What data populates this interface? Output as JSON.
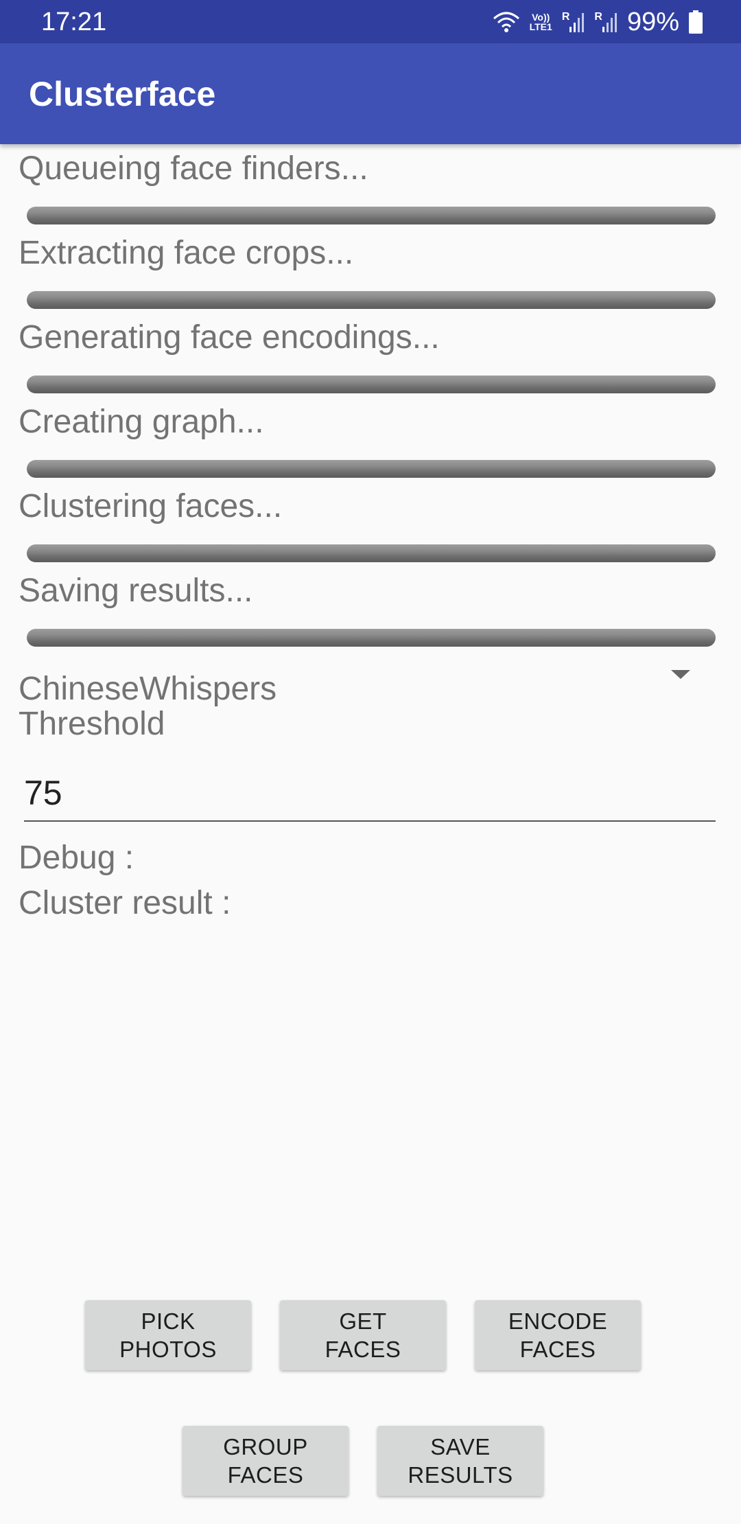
{
  "status_bar": {
    "time": "17:21",
    "network_top": "Vo))",
    "network_bottom": "LTE1",
    "roaming_1": "R",
    "roaming_2": "R",
    "battery": "99%"
  },
  "app_bar": {
    "title": "Clusterface"
  },
  "steps": [
    {
      "label": "Queueing face finders...",
      "progress": 0
    },
    {
      "label": "Extracting face crops...",
      "progress": 0
    },
    {
      "label": "Generating face encodings...",
      "progress": 0
    },
    {
      "label": "Creating graph...",
      "progress": 0
    },
    {
      "label": "Clustering faces...",
      "progress": 0
    },
    {
      "label": "Saving results...",
      "progress": 0
    }
  ],
  "algorithm_spinner": {
    "selected": "ChineseWhispers"
  },
  "threshold": {
    "label": "Threshold",
    "value": "75"
  },
  "debug": {
    "label": "Debug :"
  },
  "cluster_result": {
    "label": "Cluster result :"
  },
  "buttons": {
    "pick_photos": {
      "line1": "PICK",
      "line2": "PHOTOS"
    },
    "get_faces": {
      "line1": "GET",
      "line2": "FACES"
    },
    "encode_faces": {
      "line1": "ENCODE",
      "line2": "FACES"
    },
    "group_faces": {
      "line1": "GROUP",
      "line2": "FACES"
    },
    "save_results": {
      "line1": "SAVE",
      "line2": "RESULTS"
    }
  },
  "colors": {
    "status_bar": "#303f9f",
    "app_bar": "#3f51b5",
    "background": "#fafafa",
    "button": "#d6d7d7",
    "progress_track": "#7a7a7a"
  }
}
